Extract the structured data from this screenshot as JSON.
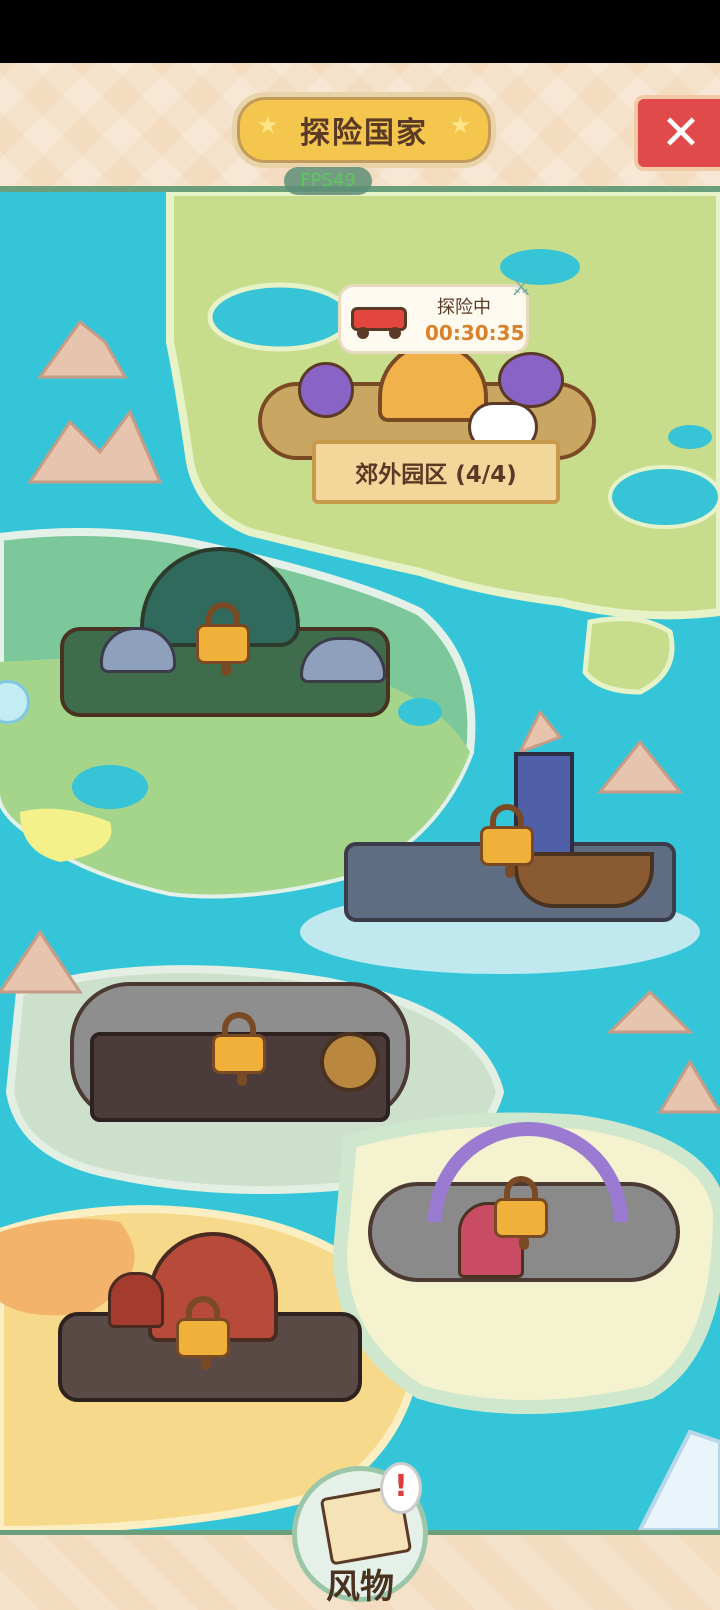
{
  "header": {
    "title": "探险国家",
    "fps": "FPS49",
    "close_icon": "close-x-icon"
  },
  "expedition": {
    "status": "探险中",
    "timer": "00:30:35",
    "vehicle_icon": "fire-truck-icon"
  },
  "regions": [
    {
      "name": "郊外园区",
      "progress": "(4/4)",
      "unlocked": true
    },
    {
      "name": "forest-region",
      "unlocked": false
    },
    {
      "name": "harbor-city-region",
      "unlocked": false
    },
    {
      "name": "steampunk-region",
      "unlocked": false
    },
    {
      "name": "candy-cloud-region",
      "unlocked": false
    },
    {
      "name": "tent-village-region",
      "unlocked": false
    }
  ],
  "region_label": "郊外园区 (4/4)",
  "bottom_nav": {
    "label": "风物",
    "badge": "!"
  },
  "colors": {
    "sea": "#35c5d8",
    "grass": "#c8dd8b",
    "header_bg": "#f3dcc0",
    "accent_green": "#6b9e7a",
    "title_gold": "#f4c64e",
    "close_red": "#e04a4a"
  }
}
